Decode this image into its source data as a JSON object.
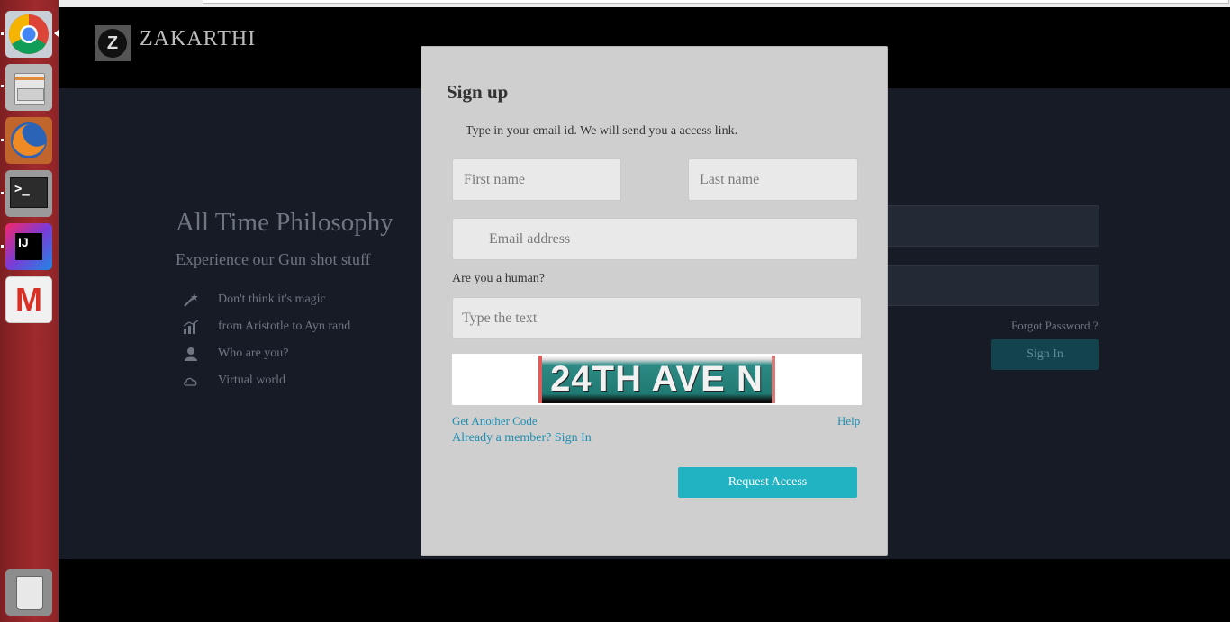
{
  "launcher": {
    "items": [
      "chrome-icon",
      "files-icon",
      "firefox-icon",
      "terminal-icon",
      "intellij-icon",
      "gmail-icon",
      "trash-icon"
    ],
    "terminal_glyph": ">_",
    "intellij_glyph": "IJ",
    "gmail_glyph": "M"
  },
  "header": {
    "logo_letter": "Z",
    "brand": "ZAKARTHI"
  },
  "hero": {
    "title": "All Time Philosophy",
    "subtitle": "Experience our Gun shot stuff",
    "features": [
      {
        "icon": "magic-wand-icon",
        "label": "Don't think it's magic"
      },
      {
        "icon": "bar-chart-icon",
        "label": "from Aristotle to Ayn rand"
      },
      {
        "icon": "user-icon",
        "label": "Who are you?"
      },
      {
        "icon": "cloud-icon",
        "label": "Virtual world"
      }
    ]
  },
  "login": {
    "forgot": "Forgot Password ?",
    "sign_in": "Sign In"
  },
  "modal": {
    "title": "Sign up",
    "description": "Type in your email id. We will send you a access link.",
    "first_name_placeholder": "First name",
    "last_name_placeholder": "Last name",
    "email_placeholder": "Email address",
    "human_label": "Are you a human?",
    "captcha_placeholder": "Type the text",
    "captcha_text": "24TH AVE N",
    "get_another_code": "Get Another Code",
    "help": "Help",
    "already_member": "Already a member? Sign In",
    "request_access": "Request Access"
  },
  "colors": {
    "launcher_bg": "#8b2226",
    "hero_bg": "#161b26",
    "modal_bg": "#cfcfcf",
    "link": "#1f8fb3",
    "accent": "#22b3c3"
  }
}
